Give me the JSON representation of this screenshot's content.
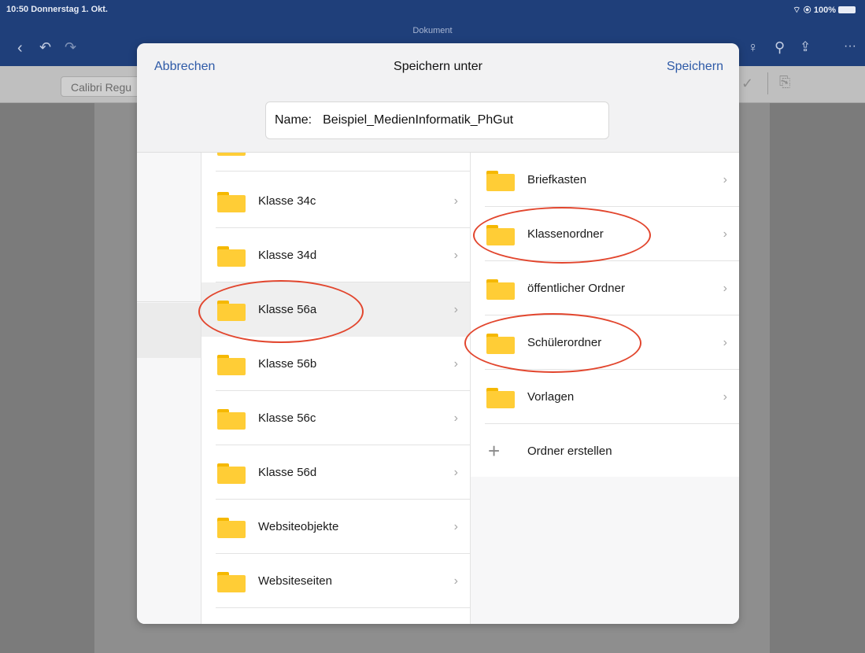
{
  "status_bar": {
    "time_date": "10:50  Donnerstag 1. Okt.",
    "battery": "100%"
  },
  "document": {
    "title": "Dokument",
    "font_name": "Calibri Regu"
  },
  "dialog": {
    "cancel_label": "Abbrechen",
    "title": "Speichern unter",
    "save_label": "Speichern",
    "name_label": "Name:",
    "name_value": "Beispiel_MedienInformatik_PhGut"
  },
  "middle_column": {
    "items": [
      {
        "label": "Klasse 34c",
        "selected": false
      },
      {
        "label": "Klasse 34d",
        "selected": false
      },
      {
        "label": "Klasse 56a",
        "selected": true
      },
      {
        "label": "Klasse 56b",
        "selected": false
      },
      {
        "label": "Klasse 56c",
        "selected": false
      },
      {
        "label": "Klasse 56d",
        "selected": false
      },
      {
        "label": "Websiteobjekte",
        "selected": false
      },
      {
        "label": "Websiteseiten",
        "selected": false
      }
    ]
  },
  "right_column": {
    "items": [
      {
        "label": "Briefkasten"
      },
      {
        "label": "Klassenordner"
      },
      {
        "label": "öffentlicher Ordner"
      },
      {
        "label": "Schülerordner"
      },
      {
        "label": "Vorlagen"
      }
    ],
    "create_label": "Ordner erstellen"
  },
  "icons": {
    "folder": "folder-icon",
    "chevron": "chevron-right-icon",
    "plus": "plus-icon"
  },
  "colors": {
    "accent": "#2e5aa7",
    "folder": "#ffcd36",
    "annotation": "#e2462e",
    "app_bar": "#1f3f7a"
  }
}
